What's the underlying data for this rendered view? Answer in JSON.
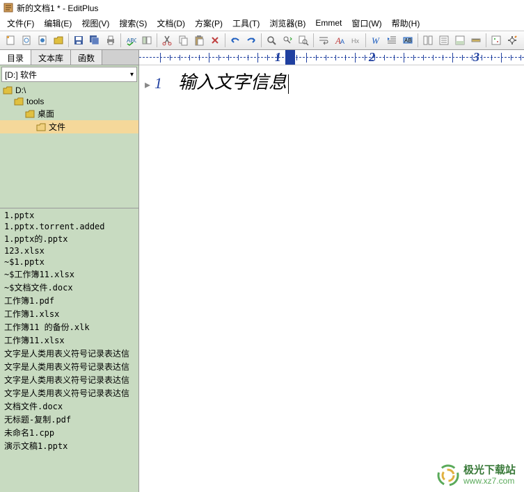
{
  "window": {
    "title": "新的文档1 * - EditPlus"
  },
  "menu": {
    "file": "文件(F)",
    "edit": "编辑(E)",
    "view": "视图(V)",
    "search": "搜索(S)",
    "document": "文档(D)",
    "project": "方案(P)",
    "tools": "工具(T)",
    "browser": "浏览器(B)",
    "emmet": "Emmet",
    "window": "窗口(W)",
    "help": "帮助(H)"
  },
  "sidebar": {
    "tabs": {
      "directory": "目录",
      "textlib": "文本库",
      "functions": "函数"
    },
    "path": "[D:] 软件",
    "tree": [
      {
        "label": "D:\\",
        "indent": 0
      },
      {
        "label": "tools",
        "indent": 1
      },
      {
        "label": "桌面",
        "indent": 2
      },
      {
        "label": "文件",
        "indent": 3,
        "selected": true
      }
    ],
    "files": [
      "1.pptx",
      "1.pptx.torrent.added",
      "1.pptx的.pptx",
      "123.xlsx",
      "~$1.pptx",
      "~$工作簿11.xlsx",
      "~$文档文件.docx",
      "工作簿1.pdf",
      "工作簿1.xlsx",
      "工作簿11 的备份.xlk",
      "工作簿11.xlsx",
      "文字是人类用表义符号记录表达信",
      "文字是人类用表义符号记录表达信",
      "文字是人类用表义符号记录表达信",
      "文字是人类用表义符号记录表达信",
      "文档文件.docx",
      "无标题-复制.pdf",
      "未命名1.cpp",
      "演示文稿1.pptx"
    ]
  },
  "ruler": {
    "marks": [
      "1",
      "2",
      "3"
    ]
  },
  "editor": {
    "line_number": "1",
    "text": "输入文字信息"
  },
  "watermark": {
    "name": "极光下载站",
    "url": "www.xz7.com"
  }
}
